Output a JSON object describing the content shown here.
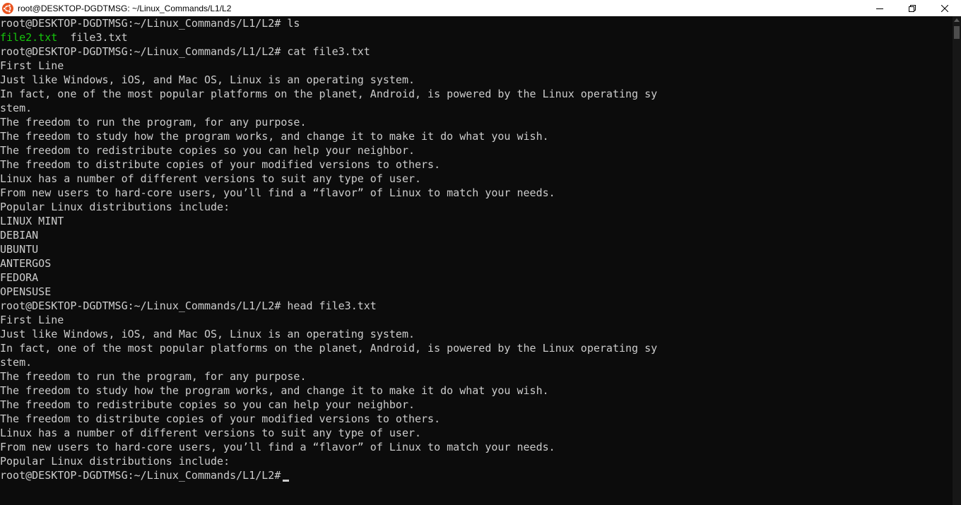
{
  "window": {
    "title": "root@DESKTOP-DGDTMSG: ~/Linux_Commands/L1/L2",
    "app_icon": "ubuntu-icon",
    "controls": {
      "minimize": "minimize-icon",
      "restore": "restore-icon",
      "close": "close-icon"
    }
  },
  "colors": {
    "background": "#0c0c0c",
    "foreground": "#cccccc",
    "executable": "#16c60c",
    "titlebar": "#ffffff",
    "ubuntu_orange": "#e95420"
  },
  "terminal": {
    "line1": "root@DESKTOP-DGDTMSG:~/Linux_Commands/L1/L2# ls",
    "ls_output": {
      "file1": "file2.txt",
      "gap": "  ",
      "file2": "file3.txt"
    },
    "line3": "root@DESKTOP-DGDTMSG:~/Linux_Commands/L1/L2# cat file3.txt",
    "line4": "First Line",
    "line5": "Just like Windows, iOS, and Mac OS, Linux is an operating system.",
    "line6": "In fact, one of the most popular platforms on the planet, Android, is powered by the Linux operating sy",
    "line7": "stem.",
    "line8": "The freedom to run the program, for any purpose.",
    "line9": "The freedom to study how the program works, and change it to make it do what you wish.",
    "line10": "The freedom to redistribute copies so you can help your neighbor.",
    "line11": "The freedom to distribute copies of your modified versions to others.",
    "line12": "Linux has a number of different versions to suit any type of user.",
    "line13": "From new users to hard-core users, you’ll find a “flavor” of Linux to match your needs.",
    "line14": "Popular Linux distributions include:",
    "line15": "LINUX MINT",
    "line16": "DEBIAN",
    "line17": "UBUNTU",
    "line18": "ANTERGOS",
    "line19": "FEDORA",
    "line20": "OPENSUSE",
    "line21": "root@DESKTOP-DGDTMSG:~/Linux_Commands/L1/L2# head file3.txt",
    "line22": "First Line",
    "line23": "Just like Windows, iOS, and Mac OS, Linux is an operating system.",
    "line24": "In fact, one of the most popular platforms on the planet, Android, is powered by the Linux operating sy",
    "line25": "stem.",
    "line26": "The freedom to run the program, for any purpose.",
    "line27": "The freedom to study how the program works, and change it to make it do what you wish.",
    "line28": "The freedom to redistribute copies so you can help your neighbor.",
    "line29": "The freedom to distribute copies of your modified versions to others.",
    "line30": "Linux has a number of different versions to suit any type of user.",
    "line31": "From new users to hard-core users, you’ll find a “flavor” of Linux to match your needs.",
    "line32": "Popular Linux distributions include:",
    "prompt": "root@DESKTOP-DGDTMSG:~/Linux_Commands/L1/L2#"
  }
}
